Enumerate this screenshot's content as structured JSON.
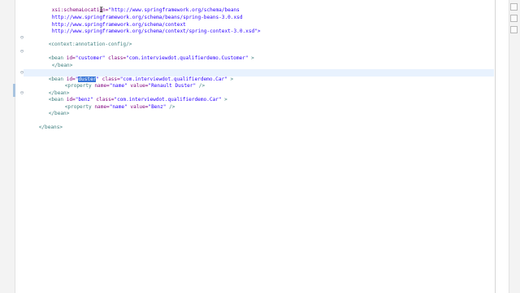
{
  "editor": {
    "lines": {
      "l1": {
        "a": "xsi:schemaLocation=",
        "b": "\"http://www.springframework.org/schema/beans"
      },
      "l2": {
        "a": "http://www.springframework.org/schema/beans/spring-beans-3.0.xsd"
      },
      "l3": {
        "a": "http://www.springframework.org/schema/context"
      },
      "l4": {
        "a": "http://www.springframework.org/schema/context/spring-context-3.0.xsd\">"
      },
      "l5": {
        "a": "<context:annotation-config/>"
      },
      "l6": {
        "t1": "<bean ",
        "a1": "id=",
        "v1": "\"customer\"",
        "a2": " class=",
        "v2": "\"com.interviewdot.qualifierdemo.Customer\"",
        "t2": " >"
      },
      "l7": {
        "t": "</bean>"
      },
      "l8": {
        "t1": "<bean ",
        "a1": "id=",
        "q": "\"",
        "sel": "duster",
        "q2": "\"",
        "a2": " class=",
        "v2": "\"com.interviewdot.qualifierdemo.Car\"",
        "t2": " >"
      },
      "l9": {
        "t1": "<property ",
        "a1": "name=",
        "v1": "\"name\"",
        "a2": " value=",
        "v2": "\"Renault Duster\"",
        "t2": " />"
      },
      "l10": {
        "t": "</bean>"
      },
      "l11": {
        "t1": "<bean ",
        "a1": "id=",
        "v1": "\"benz\"",
        "a2": " class=",
        "v2": "\"com.interviewdot.qualifierdemo.Car\"",
        "t2": " >"
      },
      "l12": {
        "t1": "<property ",
        "a1": "name=",
        "v1": "\"name\"",
        "a2": " value=",
        "v2": "\"Benz\"",
        "t2": " />"
      },
      "l13": {
        "t": "</bean>"
      },
      "l14": {
        "t": "</beans>"
      }
    }
  }
}
